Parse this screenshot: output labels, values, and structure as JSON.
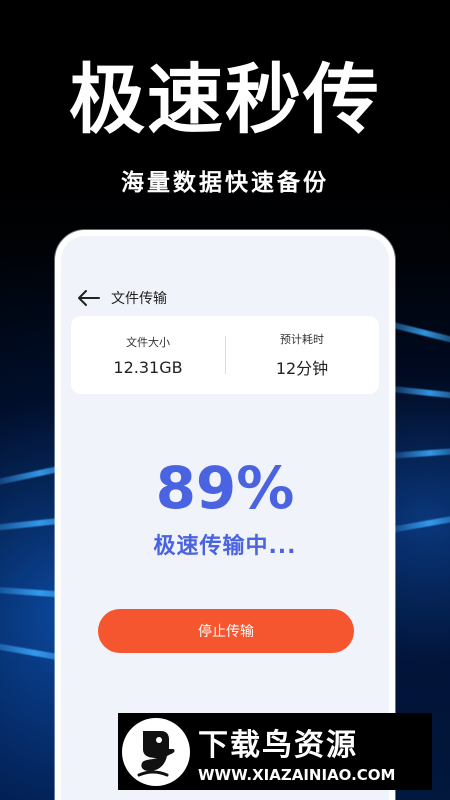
{
  "promo": {
    "headline": "极速秒传",
    "subheadline": "海量数据快速备份"
  },
  "screen": {
    "nav": {
      "title": "文件传输"
    },
    "info": {
      "size_label": "文件大小",
      "size_value": "12.31GB",
      "time_label": "预计耗时",
      "time_value": "12分钟"
    },
    "progress": {
      "percent_text": "89%",
      "value": 0.89,
      "status": "极速传输中..."
    },
    "stop_button_label": "停止传输"
  },
  "watermark": {
    "title": "下载鸟资源",
    "url": "WWW.XIAZAINIAO.COM"
  },
  "colors": {
    "accent": "#4a63e0",
    "button": "#f5562f",
    "screen_bg": "#f1f3fb"
  },
  "icons": [
    "back-arrow-icon",
    "bird-logo-icon"
  ]
}
